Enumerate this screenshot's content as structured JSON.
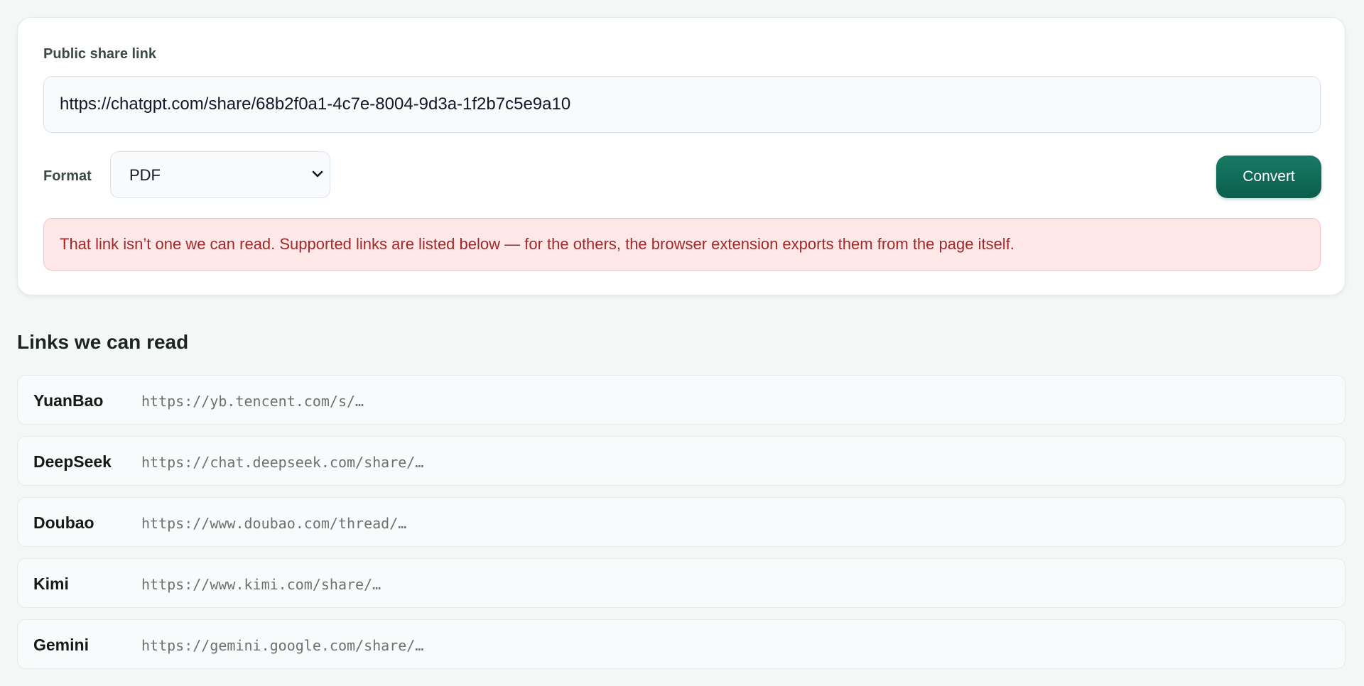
{
  "form": {
    "label": "Public share link",
    "url_value": "https://chatgpt.com/share/68b2f0a1-4c7e-8004-9d3a-1f2b7c5e9a10",
    "format_label": "Format",
    "format_selected": "PDF",
    "convert_label": "Convert",
    "error_message": "That link isn’t one we can read. Supported links are listed below — for the others, the browser extension exports them from the page itself."
  },
  "links_section": {
    "title": "Links we can read",
    "items": [
      {
        "name": "YuanBao",
        "pattern": "https://yb.tencent.com/s/…"
      },
      {
        "name": "DeepSeek",
        "pattern": "https://chat.deepseek.com/share/…"
      },
      {
        "name": "Doubao",
        "pattern": "https://www.doubao.com/thread/…"
      },
      {
        "name": "Kimi",
        "pattern": "https://www.kimi.com/share/…"
      },
      {
        "name": "Gemini",
        "pattern": "https://gemini.google.com/share/…"
      }
    ]
  },
  "colors": {
    "accent": "#0f6b58",
    "error_bg": "#fde7e7",
    "error_text": "#a12828",
    "page_bg": "#f3f7f5"
  },
  "icons": {
    "select_caret": "chevron-down-icon"
  }
}
